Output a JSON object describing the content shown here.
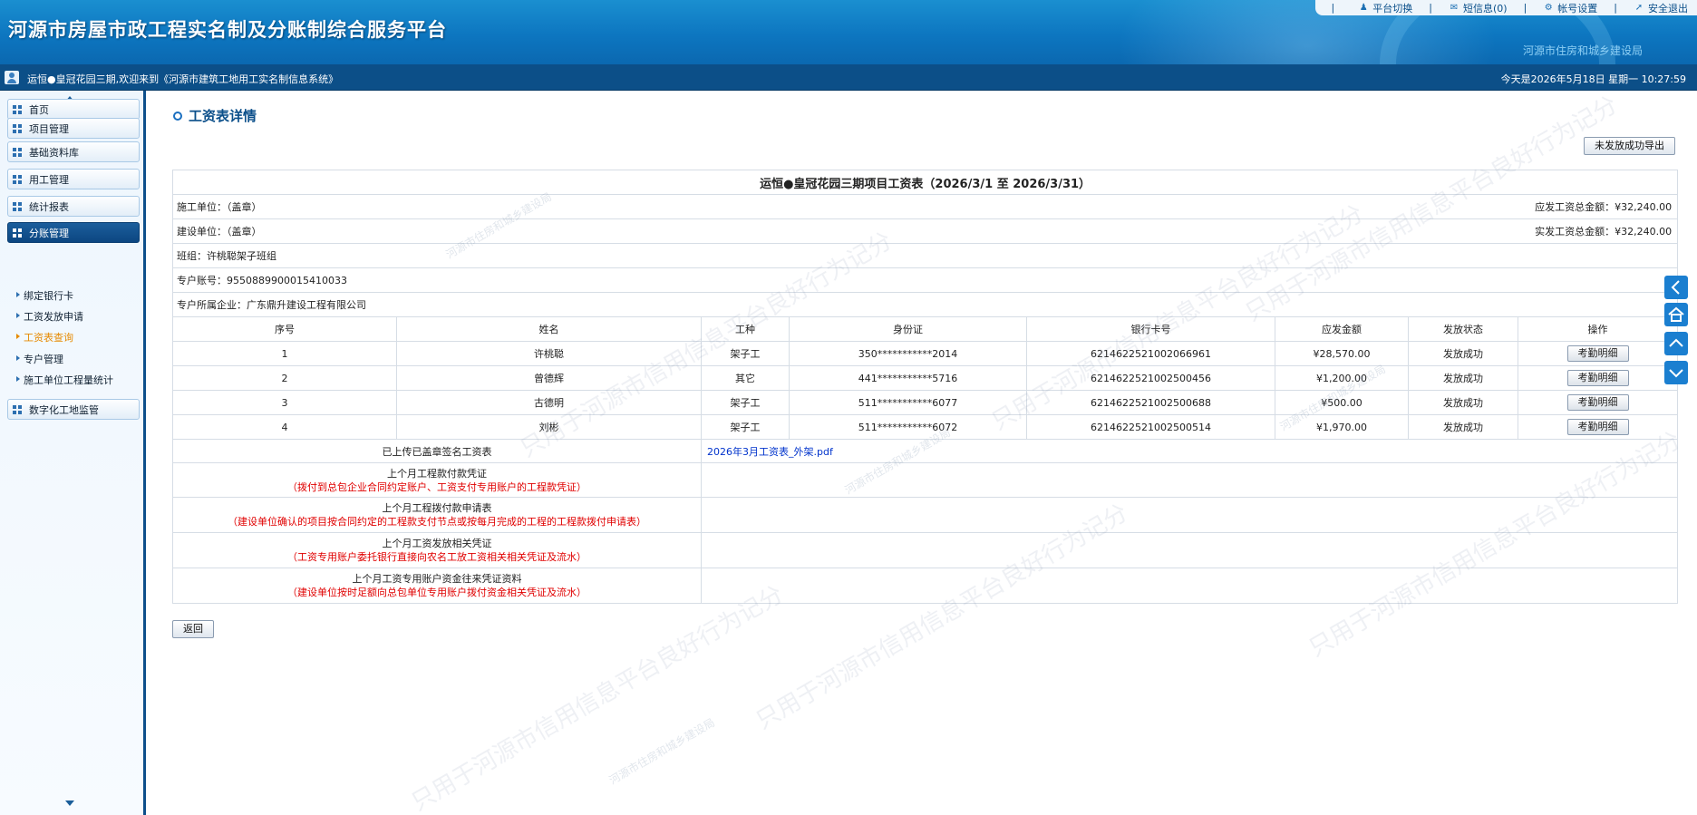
{
  "header": {
    "title": "河源市房屋市政工程实名制及分账制综合服务平台",
    "dept": "河源市住房和城乡建设局",
    "links": [
      {
        "label": "平台切换",
        "icon": "user-switch-icon"
      },
      {
        "label": "短信息(0)",
        "icon": "mail-icon"
      },
      {
        "label": "帐号设置",
        "icon": "gear-icon"
      },
      {
        "label": "安全退出",
        "icon": "logout-icon"
      }
    ]
  },
  "infobar": {
    "welcome": "运恒●皇冠花园三期,欢迎来到《河源市建筑工地用工实名制信息系统》",
    "date": "今天是2026年5月18日 星期一 10:27:59"
  },
  "sidebar": {
    "menu": [
      "首页",
      "项目管理",
      "基础资料库",
      "用工管理",
      "统计报表",
      "分账管理"
    ],
    "submenu": [
      "绑定银行卡",
      "工资发放申请",
      "工资表查询",
      "专户管理",
      "施工单位工程量统计"
    ],
    "current_submenu": "工资表查询",
    "extra_menu": "数字化工地监管"
  },
  "page": {
    "title": "工资表详情",
    "export_label": "未发放成功导出",
    "back_label": "返回"
  },
  "sheet": {
    "caption": "运恒●皇冠花园三期项目工资表（2026/3/1 至 2026/3/31）",
    "construction_unit": "施工单位：（盖章）",
    "payable_total": "应发工资总金额：¥32,240.00",
    "build_unit": "建设单位：（盖章）",
    "paid_total": "实发工资总金额：¥32,240.00",
    "team": "班组：许桃聪架子班组",
    "account": "专户账号：9550889900015410033",
    "company": "专户所属企业：广东鼎升建设工程有限公司",
    "columns": [
      "序号",
      "姓名",
      "工种",
      "身份证",
      "银行卡号",
      "应发金额",
      "发放状态",
      "操作"
    ],
    "rows": [
      {
        "no": "1",
        "name": "许桃聪",
        "type": "架子工",
        "id": "350***********2014",
        "card": "6214622521002066961",
        "amount": "¥28,570.00",
        "status": "发放成功",
        "action": "考勤明细"
      },
      {
        "no": "2",
        "name": "曾德辉",
        "type": "其它",
        "id": "441***********5716",
        "card": "6214622521002500456",
        "amount": "¥1,200.00",
        "status": "发放成功",
        "action": "考勤明细"
      },
      {
        "no": "3",
        "name": "古德明",
        "type": "架子工",
        "id": "511***********6077",
        "card": "6214622521002500688",
        "amount": "¥500.00",
        "status": "发放成功",
        "action": "考勤明细"
      },
      {
        "no": "4",
        "name": "刘彬",
        "type": "架子工",
        "id": "511***********6072",
        "card": "6214622521002500514",
        "amount": "¥1,970.00",
        "status": "发放成功",
        "action": "考勤明细"
      }
    ],
    "uploaded_label": "已上传已盖章签名工资表",
    "uploaded_file": "2026年3月工资表_外架.pdf",
    "docs": [
      {
        "title": "上个月工程款付款凭证",
        "note": "（拨付到总包企业合同约定账户、工资支付专用账户的工程款凭证）"
      },
      {
        "title": "上个月工程拨付款申请表",
        "note": "（建设单位确认的项目按合同约定的工程款支付节点或按每月完成的工程的工程款拨付申请表）"
      },
      {
        "title": "上个月工资发放相关凭证",
        "note": "（工资专用账户委托银行直接向农名工放工资相关相关凭证及流水）"
      },
      {
        "title": "上个月工资专用账户资金往来凭证资料",
        "note": "（建设单位按时足额向总包单位专用账户拨付资金相关凭证及流水）"
      }
    ]
  },
  "watermark": {
    "large": "只用于河源市信用信息平台良好行为记分",
    "small": "河源市住房和城乡建设局"
  },
  "colors": {
    "header": "#0d76c0",
    "sidebar_active": "#0c4681",
    "link": "#0033cc",
    "note_red": "#e00000",
    "current": "#e68a00"
  }
}
